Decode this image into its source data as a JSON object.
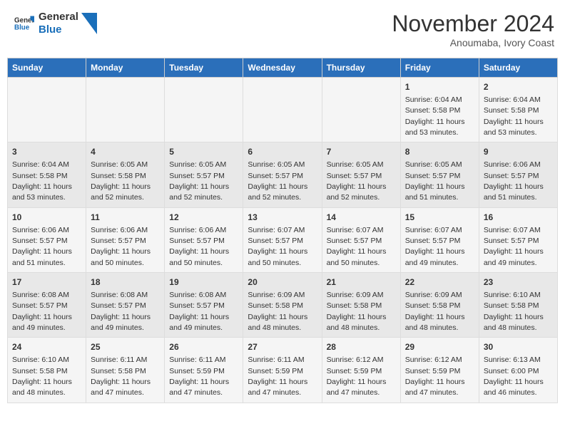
{
  "header": {
    "logo_general": "General",
    "logo_blue": "Blue",
    "month_year": "November 2024",
    "location": "Anoumaba, Ivory Coast"
  },
  "days_of_week": [
    "Sunday",
    "Monday",
    "Tuesday",
    "Wednesday",
    "Thursday",
    "Friday",
    "Saturday"
  ],
  "weeks": [
    [
      {
        "day": "",
        "info": ""
      },
      {
        "day": "",
        "info": ""
      },
      {
        "day": "",
        "info": ""
      },
      {
        "day": "",
        "info": ""
      },
      {
        "day": "",
        "info": ""
      },
      {
        "day": "1",
        "info": "Sunrise: 6:04 AM\nSunset: 5:58 PM\nDaylight: 11 hours and 53 minutes."
      },
      {
        "day": "2",
        "info": "Sunrise: 6:04 AM\nSunset: 5:58 PM\nDaylight: 11 hours and 53 minutes."
      }
    ],
    [
      {
        "day": "3",
        "info": "Sunrise: 6:04 AM\nSunset: 5:58 PM\nDaylight: 11 hours and 53 minutes."
      },
      {
        "day": "4",
        "info": "Sunrise: 6:05 AM\nSunset: 5:58 PM\nDaylight: 11 hours and 52 minutes."
      },
      {
        "day": "5",
        "info": "Sunrise: 6:05 AM\nSunset: 5:57 PM\nDaylight: 11 hours and 52 minutes."
      },
      {
        "day": "6",
        "info": "Sunrise: 6:05 AM\nSunset: 5:57 PM\nDaylight: 11 hours and 52 minutes."
      },
      {
        "day": "7",
        "info": "Sunrise: 6:05 AM\nSunset: 5:57 PM\nDaylight: 11 hours and 52 minutes."
      },
      {
        "day": "8",
        "info": "Sunrise: 6:05 AM\nSunset: 5:57 PM\nDaylight: 11 hours and 51 minutes."
      },
      {
        "day": "9",
        "info": "Sunrise: 6:06 AM\nSunset: 5:57 PM\nDaylight: 11 hours and 51 minutes."
      }
    ],
    [
      {
        "day": "10",
        "info": "Sunrise: 6:06 AM\nSunset: 5:57 PM\nDaylight: 11 hours and 51 minutes."
      },
      {
        "day": "11",
        "info": "Sunrise: 6:06 AM\nSunset: 5:57 PM\nDaylight: 11 hours and 50 minutes."
      },
      {
        "day": "12",
        "info": "Sunrise: 6:06 AM\nSunset: 5:57 PM\nDaylight: 11 hours and 50 minutes."
      },
      {
        "day": "13",
        "info": "Sunrise: 6:07 AM\nSunset: 5:57 PM\nDaylight: 11 hours and 50 minutes."
      },
      {
        "day": "14",
        "info": "Sunrise: 6:07 AM\nSunset: 5:57 PM\nDaylight: 11 hours and 50 minutes."
      },
      {
        "day": "15",
        "info": "Sunrise: 6:07 AM\nSunset: 5:57 PM\nDaylight: 11 hours and 49 minutes."
      },
      {
        "day": "16",
        "info": "Sunrise: 6:07 AM\nSunset: 5:57 PM\nDaylight: 11 hours and 49 minutes."
      }
    ],
    [
      {
        "day": "17",
        "info": "Sunrise: 6:08 AM\nSunset: 5:57 PM\nDaylight: 11 hours and 49 minutes."
      },
      {
        "day": "18",
        "info": "Sunrise: 6:08 AM\nSunset: 5:57 PM\nDaylight: 11 hours and 49 minutes."
      },
      {
        "day": "19",
        "info": "Sunrise: 6:08 AM\nSunset: 5:57 PM\nDaylight: 11 hours and 49 minutes."
      },
      {
        "day": "20",
        "info": "Sunrise: 6:09 AM\nSunset: 5:58 PM\nDaylight: 11 hours and 48 minutes."
      },
      {
        "day": "21",
        "info": "Sunrise: 6:09 AM\nSunset: 5:58 PM\nDaylight: 11 hours and 48 minutes."
      },
      {
        "day": "22",
        "info": "Sunrise: 6:09 AM\nSunset: 5:58 PM\nDaylight: 11 hours and 48 minutes."
      },
      {
        "day": "23",
        "info": "Sunrise: 6:10 AM\nSunset: 5:58 PM\nDaylight: 11 hours and 48 minutes."
      }
    ],
    [
      {
        "day": "24",
        "info": "Sunrise: 6:10 AM\nSunset: 5:58 PM\nDaylight: 11 hours and 48 minutes."
      },
      {
        "day": "25",
        "info": "Sunrise: 6:11 AM\nSunset: 5:58 PM\nDaylight: 11 hours and 47 minutes."
      },
      {
        "day": "26",
        "info": "Sunrise: 6:11 AM\nSunset: 5:59 PM\nDaylight: 11 hours and 47 minutes."
      },
      {
        "day": "27",
        "info": "Sunrise: 6:11 AM\nSunset: 5:59 PM\nDaylight: 11 hours and 47 minutes."
      },
      {
        "day": "28",
        "info": "Sunrise: 6:12 AM\nSunset: 5:59 PM\nDaylight: 11 hours and 47 minutes."
      },
      {
        "day": "29",
        "info": "Sunrise: 6:12 AM\nSunset: 5:59 PM\nDaylight: 11 hours and 47 minutes."
      },
      {
        "day": "30",
        "info": "Sunrise: 6:13 AM\nSunset: 6:00 PM\nDaylight: 11 hours and 46 minutes."
      }
    ]
  ]
}
